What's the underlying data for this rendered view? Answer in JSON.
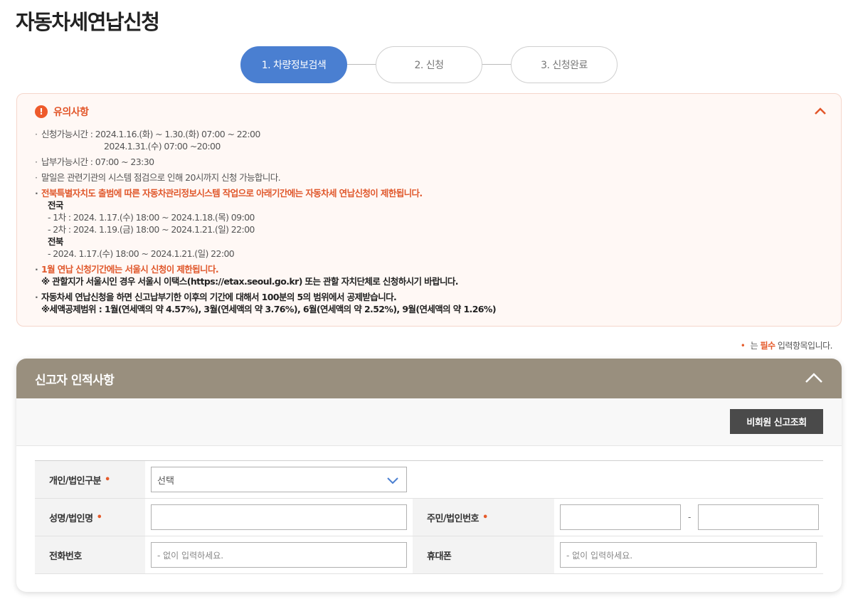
{
  "page": {
    "title": "자동차세연납신청"
  },
  "steps": [
    {
      "label": "1. 차량정보검색",
      "active": true
    },
    {
      "label": "2. 신청",
      "active": false
    },
    {
      "label": "3. 신청완료",
      "active": false
    }
  ],
  "notice": {
    "title": "유의사항",
    "lines": {
      "apply_time_1": "신청가능시간 : 2024.1.16.(화) ~ 1.30.(화) 07:00 ~ 22:00",
      "apply_time_2": "2024.1.31.(수) 07:00 ~20:00",
      "pay_time": "납부가능시간 : 07:00 ~ 23:30",
      "month_end": "말일은 관련기관의 시스템 점검으로 인해 20시까지 신청 가능합니다.",
      "jeonbuk_notice": "전북특별자치도 출범에 따른 자동차관리정보시스템 작업으로 아래기간에는 자동차세 연납신청이 제한됩니다.",
      "nationwide_label": "전국",
      "nationwide_1": "- 1차 : 2024. 1.17.(수) 18:00 ~ 2024.1.18.(목) 09:00",
      "nationwide_2": "- 2차 : 2024. 1.19.(금) 18:00 ~ 2024.1.21.(일) 22:00",
      "jeonbuk_label": "전북",
      "jeonbuk_1": "- 2024. 1.17.(수) 18:00 ~ 2024.1.21.(일) 22:00",
      "seoul_notice": "1월 연납 신청기간에는 서울시 신청이 제한됩니다.",
      "seoul_detail": "※ 관할지가 서울시인 경우 서울시 이택스(https://etax.seoul.go.kr) 또는 관할 자치단체로 신청하시기 바랍니다.",
      "deduction_1": "자동차세 연납신청을 하면 신고납부기한 이후의 기간에 대해서 100분의 5의 범위에서 공제받습니다.",
      "deduction_2": "※세액공제범위 : 1월(연세액의 약 4.57%), 3월(연세액의 약 3.76%), 6월(연세액의 약 2.52%), 9월(연세액의 약 1.26%)"
    }
  },
  "required_note": {
    "prefix": "는",
    "required": "필수",
    "suffix": "입력항목입니다."
  },
  "form": {
    "section_title": "신고자 인적사항",
    "lookup_button": "비회원 신고조회",
    "fields": {
      "type_label": "개인/법인구분",
      "type_value": "선택",
      "name_label": "성명/법인명",
      "id_label": "주민/법인번호",
      "phone_label": "전화번호",
      "phone_placeholder": "- 없이 입력하세요.",
      "mobile_label": "휴대폰",
      "mobile_placeholder": "- 없이 입력하세요."
    }
  },
  "colors": {
    "accent": "#4a7fd1",
    "warning": "#e2562a",
    "section_header": "#998f7e"
  }
}
